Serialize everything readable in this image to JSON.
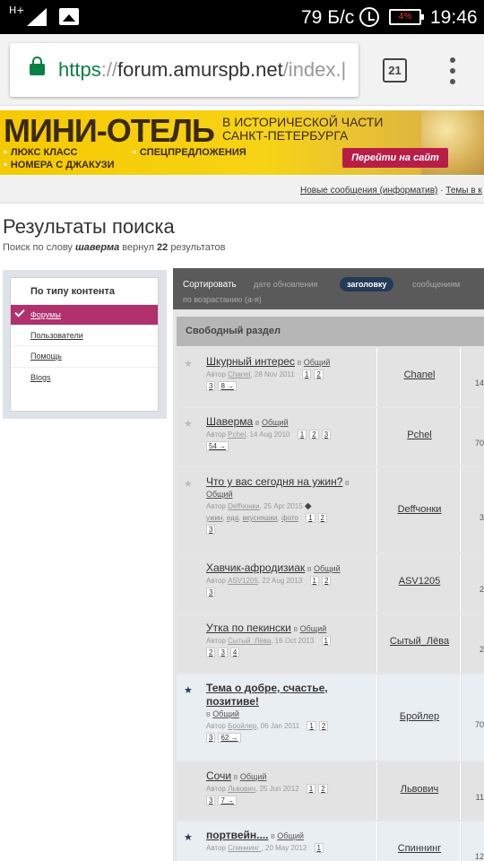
{
  "status_bar": {
    "network": "H+",
    "speed": "79 Б/с",
    "battery": "4%",
    "time": "19:46"
  },
  "browser": {
    "url_scheme": "https",
    "url_sep": "://",
    "url_host": "forum.amurspb.net",
    "url_path": "/index.|",
    "tab_count": "21"
  },
  "banner": {
    "title": "МИНИ-ОТЕЛЬ",
    "subtitle_1": "В ИСТОРИЧЕСКОЙ ЧАСТИ",
    "subtitle_2": "САНКТ-ПЕТЕРБУРГА",
    "bullets": [
      "ЛЮКС КЛАСС",
      "НОМЕРА С ДЖАКУЗИ",
      "СПЕЦПРЕДЛОЖЕНИЯ"
    ],
    "cta": "Перейти на сайт"
  },
  "nav": {
    "new_posts": "Новые сообщения (информатив)",
    "separator": " · ",
    "topics": "Темы в к"
  },
  "page": {
    "title": "Результаты поиска",
    "summary_prefix": "Поиск по слову ",
    "query": "шаверма",
    "summary_mid": " вернул ",
    "count": "22",
    "summary_suffix": " результатов"
  },
  "sidebar": {
    "heading": "По типу контента",
    "items": [
      "Форумы",
      "Пользователи",
      "Помощь",
      "Blogs"
    ]
  },
  "sort": {
    "label": "Сортировать",
    "options": [
      "дате обновления",
      "заголовку",
      "сообщениям"
    ],
    "order": "по возрастанию (а-я)"
  },
  "section": "Свободный раздел",
  "rows": [
    {
      "title": "Шкурный интерес",
      "in": " в ",
      "forum": "Общий",
      "by": "Автор ",
      "user": "Chanel",
      "date": ", 28 Nov 2011",
      "pages_l1": [
        "1",
        "2"
      ],
      "pages_l2": [
        "3",
        "8 →"
      ],
      "author": "Chanel",
      "count": "14"
    },
    {
      "title": "Шаверма",
      "in": " в ",
      "forum": "Общий",
      "by": "Автор ",
      "user": "Pchel",
      "date": ", 14 Aug 2010",
      "pages_l1": [
        "1",
        "2",
        "3"
      ],
      "pages_l2": [
        "54 →"
      ],
      "author": "Pchel",
      "count": "70"
    },
    {
      "title": "Что у вас сегодня на ужин?",
      "in": " в",
      "forum": "Общий",
      "by": "Автор ",
      "user": "Deffчонки",
      "date": ", 25 Apr 2015",
      "tags": [
        "ужин",
        "еда",
        "вкусняшки",
        "фото"
      ],
      "pages_l1": [
        "1",
        "2"
      ],
      "pages_l2": [
        "3"
      ],
      "author": "Deffчонки",
      "count": "3"
    },
    {
      "title": "Хавчик-афродизиак",
      "in": " в ",
      "forum": "Общий",
      "by": "Автор ",
      "user": "ASV1205",
      "date": ", 22 Aug 2013",
      "pages_l1": [
        "1",
        "2"
      ],
      "pages_l2": [
        "3"
      ],
      "author": "ASV1205",
      "count": "2"
    },
    {
      "title": "Утка по пекински",
      "in": " в ",
      "forum": "Общий",
      "by": "Автор ",
      "user": "Сытый_Лёва",
      "date": ", 16 Oct 2013",
      "pages_l1": [
        "1"
      ],
      "pages_l2": [
        "2",
        "3",
        "4"
      ],
      "author": "Сытый_Лёва",
      "count": "2"
    },
    {
      "title": "Тема о добре, счастье, позитиве!",
      "in": "в ",
      "forum": "Общий",
      "by": "Автор ",
      "user": "Бройлер",
      "date": ", 06 Jan 2011",
      "pages_l1": [
        "1",
        "2"
      ],
      "pages_l2": [
        "3",
        "62 →"
      ],
      "author": "Бройлер",
      "count": "70"
    },
    {
      "title": "Сочи",
      "in": " в ",
      "forum": "Общий",
      "by": "Автор ",
      "user": "Львович",
      "date": ", 25 Jun 2012",
      "pages_l1": [
        "1",
        "2"
      ],
      "pages_l2": [
        "3",
        "7 →"
      ],
      "author": "Львович",
      "count": "11"
    },
    {
      "title": "портвейн....",
      "in": " в ",
      "forum": "Общий",
      "by": "Автор ",
      "user": "Спиннинг ",
      "date": ", 20 May 2012",
      "pages_l1": [
        "1"
      ],
      "pages_l2": [],
      "author": "Спиннинг",
      "count": "12"
    }
  ],
  "colors": {
    "accent": "#b0316c",
    "sort_pill": "#233a58",
    "banner": "#f5c900",
    "lock": "#0b8043"
  }
}
